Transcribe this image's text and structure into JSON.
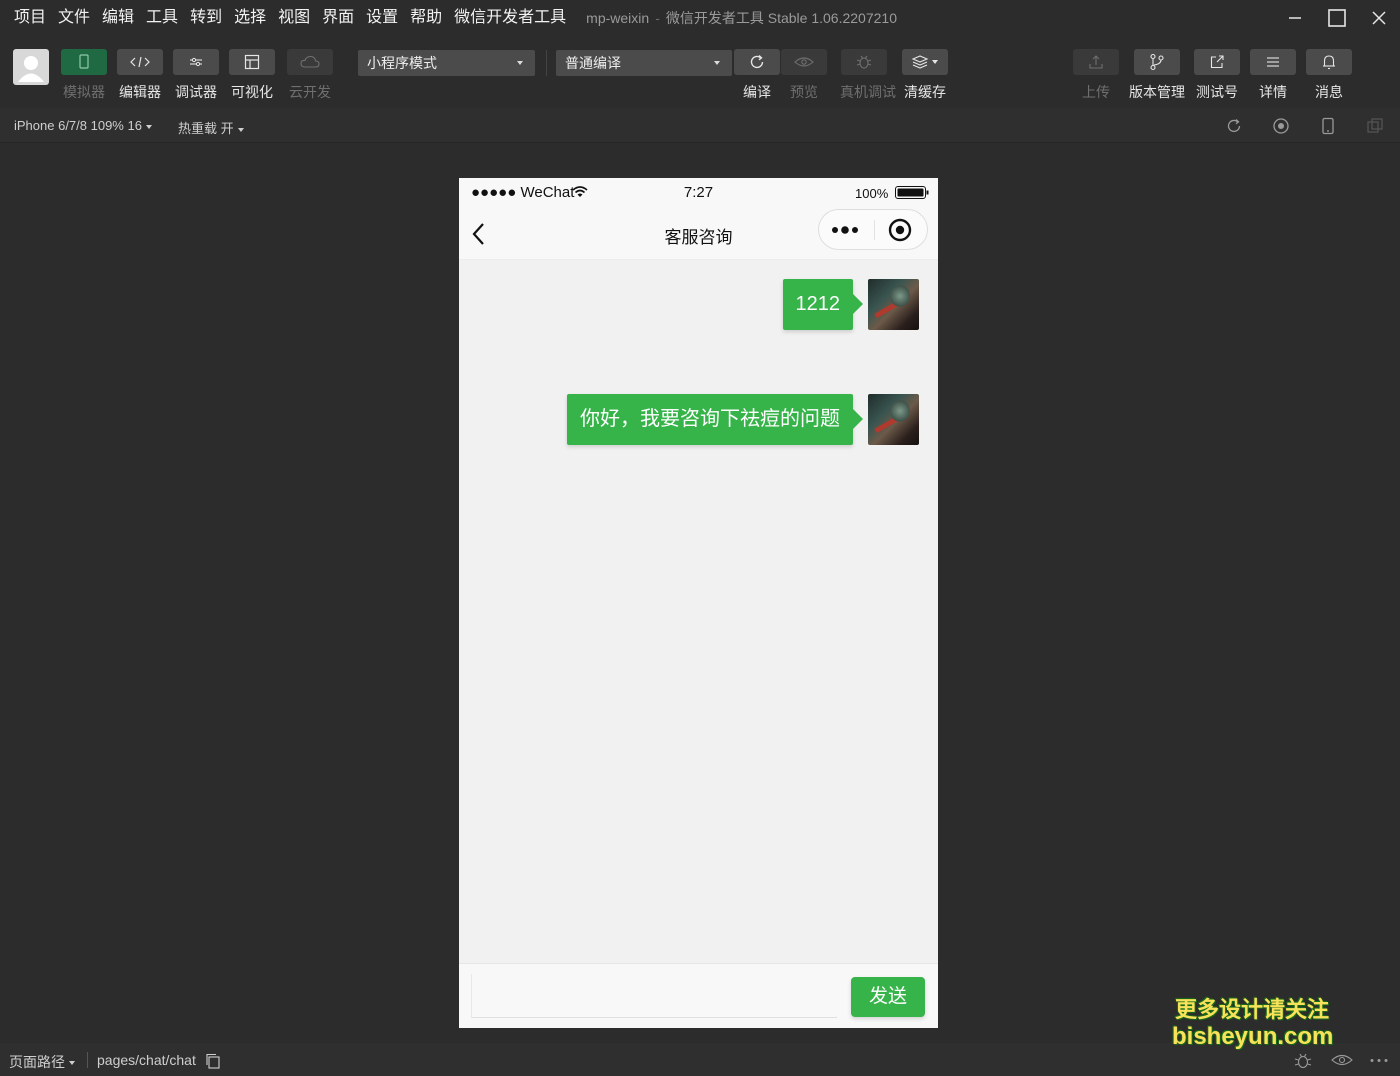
{
  "menu": [
    "项目",
    "文件",
    "编辑",
    "工具",
    "转到",
    "选择",
    "视图",
    "界面",
    "设置",
    "帮助",
    "微信开发者工具"
  ],
  "window": {
    "project": "mp-weixin",
    "separator": "-",
    "title": "微信开发者工具 Stable 1.06.2207210"
  },
  "toolbar": {
    "left_tools": [
      {
        "label": "模拟器",
        "icon": "phone-icon"
      },
      {
        "label": "编辑器",
        "icon": "code-icon"
      },
      {
        "label": "调试器",
        "icon": "debug-toggle-icon"
      },
      {
        "label": "可视化",
        "icon": "layout-icon"
      },
      {
        "label": "云开发",
        "icon": "cloud-icon"
      }
    ],
    "mode_select": "小程序模式",
    "compile_select": "普通编译",
    "compile_tools": [
      {
        "label": "编译",
        "icon": "refresh-icon"
      },
      {
        "label": "预览",
        "icon": "eye-icon"
      },
      {
        "label": "真机调试",
        "icon": "bug-icon"
      },
      {
        "label": "清缓存",
        "icon": "layers-icon"
      }
    ],
    "right_tools": [
      {
        "label": "上传",
        "icon": "upload-icon"
      },
      {
        "label": "版本管理",
        "icon": "branch-icon"
      },
      {
        "label": "测试号",
        "icon": "external-link-icon"
      },
      {
        "label": "详情",
        "icon": "menu-icon"
      },
      {
        "label": "消息",
        "icon": "bell-icon"
      }
    ]
  },
  "subbar": {
    "device": "iPhone 6/7/8 109% 16",
    "hot_reload": "热重载 开"
  },
  "phone": {
    "status": {
      "carrier": "●●●●● WeChat",
      "time": "7:27",
      "battery": "100%"
    },
    "nav_title": "客服咨询",
    "messages": [
      {
        "text": "1212"
      },
      {
        "text": "你好，我要咨询下祛痘的问题"
      }
    ],
    "input_placeholder": "",
    "send_label": "发送"
  },
  "bottom": {
    "path_label": "页面路径",
    "path": "pages/chat/chat"
  },
  "watermark": {
    "line1": "更多设计请关注",
    "line2": "bisheyun.com"
  },
  "colors": {
    "accent_green": "#36b44a",
    "active_tool": "#1f6a43",
    "chrome_bg": "#2c2c2c",
    "watermark": "#f7e25a"
  }
}
